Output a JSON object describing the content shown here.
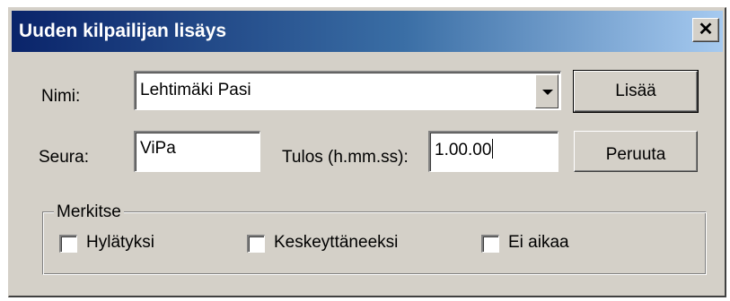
{
  "dialog": {
    "title": "Uuden kilpailijan lisäys",
    "close_glyph": "✕"
  },
  "form": {
    "name_label": "Nimi:",
    "name_value": "Lehtimäki Pasi",
    "club_label": "Seura:",
    "club_value": "ViPa",
    "result_label": "Tulos (h.mm.ss):",
    "result_value": "1.00.00"
  },
  "buttons": {
    "add": "Lisää",
    "cancel": "Peruuta"
  },
  "mark_group": {
    "label": "Merkitse",
    "options": [
      {
        "label": "Hylätyksi",
        "checked": false
      },
      {
        "label": "Keskeyttäneeksi",
        "checked": false
      },
      {
        "label": "Ei aikaa",
        "checked": false
      }
    ]
  },
  "icons": {
    "close": "close-icon",
    "dropdown": "chevron-down-icon"
  },
  "colors": {
    "title_gradient_start": "#0a246a",
    "title_gradient_end": "#a6caf0",
    "face": "#d4d0c8"
  }
}
